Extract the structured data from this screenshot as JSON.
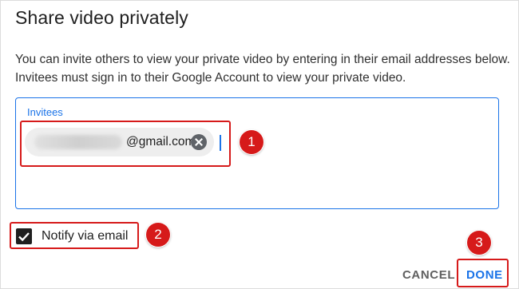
{
  "dialog": {
    "title": "Share video privately",
    "description": "You can invite others to view your private video by entering in their email addresses below. Invitees must sign in to their Google Account to view your private video.",
    "invitees": {
      "label": "Invitees",
      "chips": [
        {
          "email_visible": "@gmail.com",
          "remove_icon": "close-circle-icon"
        }
      ]
    },
    "notify": {
      "label": "Notify via email",
      "checked": true
    },
    "actions": {
      "cancel_label": "CANCEL",
      "done_label": "DONE"
    }
  },
  "annotations": [
    {
      "number": "1"
    },
    {
      "number": "2"
    },
    {
      "number": "3"
    }
  ],
  "colors": {
    "accent": "#1a73e8",
    "highlight": "#d61a1a",
    "text": "#202020"
  }
}
